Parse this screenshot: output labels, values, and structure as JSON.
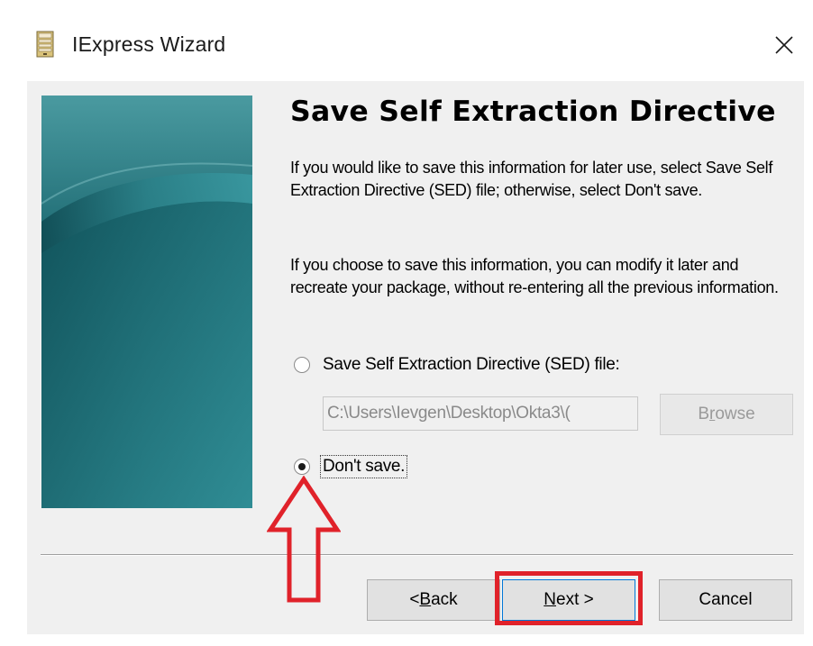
{
  "window": {
    "title": "IExpress Wizard",
    "close_symbol": "✕"
  },
  "page": {
    "heading": "Save Self Extraction Directive",
    "paragraph1": "If you would like to save this information for later use, select Save Self Extraction Directive (SED) file; otherwise, select Don't save.",
    "paragraph2": "If you choose to save this information, you can modify it later and recreate your package, without re-entering all the previous information."
  },
  "options": {
    "save_sed_label": "Save Self Extraction Directive (SED) file:",
    "save_sed_selected": false,
    "path_value": "C:\\Users\\Ievgen\\Desktop\\Okta3\\(",
    "browse_label_pre": "B",
    "browse_label_key": "r",
    "browse_label_post": "owse",
    "dont_save_label": "Don't save.",
    "dont_save_selected": true
  },
  "buttons": {
    "back_pre": "< ",
    "back_key": "B",
    "back_post": "ack",
    "next_key": "N",
    "next_post": "ext >",
    "cancel": "Cancel"
  },
  "colors": {
    "annotation_red": "#e0222a",
    "banner_teal": "#2a7f86",
    "dialog_bg": "#f0f0f0"
  },
  "icons": {
    "app": "iexpress-app-icon",
    "close": "close-icon",
    "annotation_arrow": "up-arrow-outline"
  }
}
